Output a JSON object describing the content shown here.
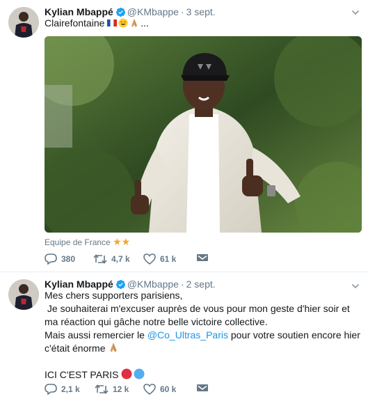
{
  "colors": {
    "accent": "#1b95e0",
    "verified": "#1da1f2",
    "muted": "#657786",
    "star": "#f5a623"
  },
  "tweets": [
    {
      "author": {
        "name": "Kylian Mbappé",
        "handle": "@KMbappe"
      },
      "date": "3 sept.",
      "text": "Clairefontaine",
      "text_suffix": "...",
      "emojis": [
        "france-flag",
        "grinning-face",
        "praying-hands"
      ],
      "location": "Equipe de France",
      "location_emojis": [
        "star",
        "star"
      ],
      "stats": {
        "replies": "380",
        "retweets": "4,7 k",
        "likes": "61 k"
      }
    },
    {
      "author": {
        "name": "Kylian Mbappé",
        "handle": "@KMbappe"
      },
      "date": "2 sept.",
      "lines": [
        "Mes chers supporters parisiens,",
        " Je souhaiterai m'excuser auprès de vous pour mon geste d'hier soir et ma réaction qui gâche notre belle victoire collective."
      ],
      "line3_before": "Mais aussi remercier le ",
      "mention": "@Co_Ultras_Paris",
      "line3_after": " pour votre soutien encore hier c'était énorme",
      "final_line": "ICI C'EST PARIS",
      "final_emojis": [
        "red-circle",
        "blue-circle"
      ],
      "stats": {
        "replies": "2,1 k",
        "retweets": "12 k",
        "likes": "60 k"
      }
    }
  ]
}
